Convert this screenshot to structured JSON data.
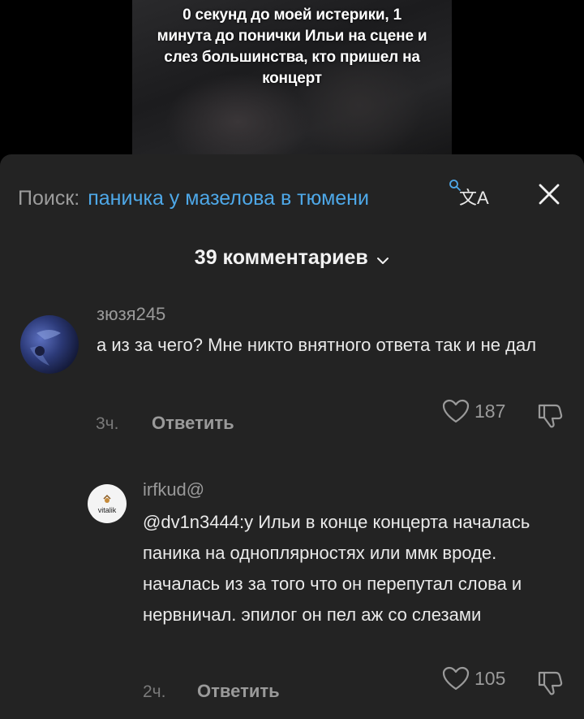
{
  "video": {
    "caption": "0 секунд до моей истерики, 1 минута до понички Ильи на сцене и слез большинства, кто пришел на концерт"
  },
  "search": {
    "label": "Поиск:",
    "query": "паничка у мазелова в тюмени",
    "translate_icon_glyph": "文A"
  },
  "comments_header": {
    "count_label": "39 комментариев"
  },
  "comments": [
    {
      "username": "зюзя245",
      "text": "а из за чего? Мне никто внятного ответа так и не дал",
      "time": "3ч.",
      "reply_label": "Ответить",
      "likes": "187"
    },
    {
      "username": "irfkud@",
      "avatar_text": "vitalik",
      "text": "@dv1n3444:у Ильи в конце концерта началась паника на одноплярностях или ммк вроде. началась из за того что он перепутал слова и нервничал. эпилог он пел аж со слезами",
      "time": "2ч.",
      "reply_label": "Ответить",
      "likes": "105"
    }
  ],
  "colors": {
    "sheet_bg": "#232323",
    "query_link": "#4ea8e8",
    "muted": "#9a9a9a"
  }
}
